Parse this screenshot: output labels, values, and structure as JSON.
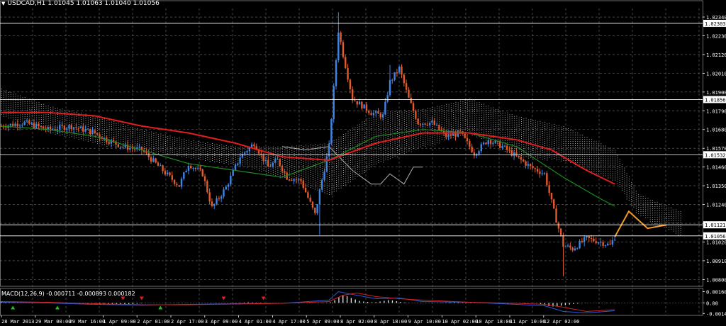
{
  "header": {
    "symbol": "USDCAD,H1",
    "quote": "1.01045 1.01063 1.01040 1.01056"
  },
  "macd_panel": {
    "label": "MACD(12,26,9) -0.000711 -0.000893 0.000182"
  },
  "colors": {
    "background": "#000000",
    "grid": "#6f6f6f",
    "bull_candle": "#3d85e6",
    "bear_candle": "#e05a2a",
    "ma_fast": "#1e8c1e",
    "ma_slow": "#e01e1e",
    "ichimoku_cloud": "#c9c9c9",
    "chikou": "#b0b0b0",
    "macd_hist": "#e8e8e8",
    "macd_main": "#2a5bd8",
    "macd_signal": "#d02020",
    "forecast": "#f59a23",
    "hline": "#ffffff"
  },
  "chart_data": [
    {
      "type": "candlestick",
      "title": "USDCAD,H1",
      "y_ticks": [
        "1.02340",
        "1.02230",
        "1.02120",
        "1.02010",
        "1.01900",
        "1.01790",
        "1.01680",
        "1.01570",
        "1.01460",
        "1.01350",
        "1.01240",
        "1.01130",
        "1.01020",
        "1.00910",
        "1.00800"
      ],
      "ylim": [
        1.0076,
        1.0239
      ],
      "horizontal_levels": [
        "1.02303",
        "1.01856",
        "1.01532",
        "1.01121",
        "1.01056"
      ],
      "x_ticks": [
        "28 Mar 2013",
        "29 Mar 00:00",
        "29 Mar 16:00",
        "1 Apr 09:00",
        "2 Apr 01:00",
        "2 Apr 17:00",
        "3 Apr 09:00",
        "4 Apr 01:00",
        "4 Apr 17:00",
        "5 Apr 09:00",
        "8 Apr 02:00",
        "8 Apr 18:00",
        "9 Apr 10:00",
        "10 Apr 02:00",
        "10 Apr 18:00",
        "11 Apr 10:00",
        "12 Apr 02:00"
      ],
      "close_path": [
        [
          0,
          1.017
        ],
        [
          10,
          1.0172
        ],
        [
          20,
          1.0168
        ],
        [
          30,
          1.017
        ],
        [
          40,
          1.0166
        ],
        [
          45,
          1.0162
        ],
        [
          52,
          1.0158
        ],
        [
          60,
          1.0156
        ],
        [
          66,
          1.0148
        ],
        [
          72,
          1.014
        ],
        [
          76,
          1.0135
        ],
        [
          80,
          1.0148
        ],
        [
          86,
          1.0142
        ],
        [
          90,
          1.0122
        ],
        [
          96,
          1.0134
        ],
        [
          102,
          1.0152
        ],
        [
          108,
          1.016
        ],
        [
          114,
          1.0146
        ],
        [
          118,
          1.015
        ],
        [
          122,
          1.014
        ],
        [
          128,
          1.0138
        ],
        [
          134,
          1.0118
        ],
        [
          136,
          1.0132
        ],
        [
          140,
          1.0158
        ],
        [
          144,
          1.0226
        ],
        [
          146,
          1.0212
        ],
        [
          150,
          1.0186
        ],
        [
          154,
          1.0182
        ],
        [
          158,
          1.0178
        ],
        [
          163,
          1.0176
        ],
        [
          166,
          1.0196
        ],
        [
          170,
          1.0204
        ],
        [
          174,
          1.0186
        ],
        [
          178,
          1.0172
        ],
        [
          184,
          1.0172
        ],
        [
          190,
          1.0164
        ],
        [
          196,
          1.0166
        ],
        [
          202,
          1.0154
        ],
        [
          208,
          1.0162
        ],
        [
          214,
          1.0158
        ],
        [
          220,
          1.0152
        ],
        [
          226,
          1.0146
        ],
        [
          232,
          1.0142
        ],
        [
          236,
          1.012
        ],
        [
          240,
          1.01
        ],
        [
          244,
          1.0098
        ],
        [
          250,
          1.0104
        ],
        [
          256,
          1.0102
        ],
        [
          260,
          1.01
        ],
        [
          262,
          1.0105
        ]
      ],
      "ma_fast": [
        [
          0,
          1.017
        ],
        [
          20,
          1.0168
        ],
        [
          40,
          1.0164
        ],
        [
          60,
          1.0156
        ],
        [
          80,
          1.0148
        ],
        [
          100,
          1.0144
        ],
        [
          120,
          1.014
        ],
        [
          140,
          1.015
        ],
        [
          160,
          1.0164
        ],
        [
          180,
          1.0168
        ],
        [
          200,
          1.0166
        ],
        [
          220,
          1.0158
        ],
        [
          240,
          1.014
        ],
        [
          255,
          1.0128
        ],
        [
          262,
          1.0123
        ]
      ],
      "ma_slow": [
        [
          0,
          1.0178
        ],
        [
          20,
          1.0178
        ],
        [
          40,
          1.0176
        ],
        [
          60,
          1.017
        ],
        [
          80,
          1.0166
        ],
        [
          100,
          1.016
        ],
        [
          120,
          1.0152
        ],
        [
          140,
          1.015
        ],
        [
          160,
          1.016
        ],
        [
          180,
          1.0166
        ],
        [
          200,
          1.0166
        ],
        [
          220,
          1.0162
        ],
        [
          235,
          1.0156
        ],
        [
          250,
          1.0144
        ],
        [
          262,
          1.0136
        ]
      ],
      "cloud_top": [
        [
          0,
          1.0192
        ],
        [
          20,
          1.0182
        ],
        [
          40,
          1.0176
        ],
        [
          60,
          1.0168
        ],
        [
          80,
          1.0162
        ],
        [
          100,
          1.0158
        ],
        [
          120,
          1.0158
        ],
        [
          140,
          1.016
        ],
        [
          160,
          1.0178
        ],
        [
          180,
          1.018
        ],
        [
          200,
          1.0186
        ],
        [
          220,
          1.0176
        ],
        [
          240,
          1.017
        ],
        [
          262,
          1.0156
        ],
        [
          272,
          1.013
        ],
        [
          290,
          1.012
        ]
      ],
      "cloud_bottom": [
        [
          0,
          1.0176
        ],
        [
          20,
          1.0166
        ],
        [
          40,
          1.016
        ],
        [
          60,
          1.0156
        ],
        [
          80,
          1.0152
        ],
        [
          100,
          1.0148
        ],
        [
          120,
          1.014
        ],
        [
          140,
          1.013
        ],
        [
          160,
          1.0148
        ],
        [
          180,
          1.0158
        ],
        [
          200,
          1.0166
        ],
        [
          220,
          1.0152
        ],
        [
          240,
          1.015
        ],
        [
          262,
          1.0138
        ],
        [
          272,
          1.0118
        ],
        [
          290,
          1.0106
        ]
      ],
      "chikou": [
        [
          120,
          1.0158
        ],
        [
          130,
          1.0156
        ],
        [
          140,
          1.0158
        ],
        [
          150,
          1.0144
        ],
        [
          158,
          1.0136
        ],
        [
          162,
          1.0136
        ],
        [
          166,
          1.0142
        ],
        [
          172,
          1.0136
        ],
        [
          176,
          1.0146
        ],
        [
          180,
          1.0146
        ]
      ],
      "forecast": [
        [
          262,
          1.0105
        ],
        [
          268,
          1.012
        ],
        [
          276,
          1.011
        ],
        [
          284,
          1.0112
        ]
      ]
    },
    {
      "type": "line",
      "title": "MACD(12,26,9) -0.000711 -0.000893 0.000182",
      "y_ticks": [
        "0.001605",
        "0.00",
        "-0.001475"
      ],
      "ylim": [
        -0.00175,
        0.00185
      ],
      "histogram": [
        0.0002,
        0.00018,
        0.00016,
        0.00015,
        0.00014,
        0.00012,
        0.0001,
        8e-05,
        6e-05,
        5e-05,
        4e-05,
        3e-05,
        2e-05,
        1e-05,
        0.0,
        -2e-05,
        -4e-05,
        -6e-05,
        -8e-05,
        -0.0001,
        -0.00012,
        -0.00015,
        -0.00018,
        -0.0002,
        -0.00022,
        -0.00024,
        -0.00025,
        -0.00026,
        -0.00026,
        -0.00025,
        -0.00022,
        -0.00018,
        -0.00014,
        -0.0001,
        -6e-05,
        -4e-05,
        -2e-05,
        -1e-05,
        0.0,
        1e-05,
        2e-05,
        3e-05,
        4e-05,
        4e-05,
        4e-05,
        3e-05,
        2e-05,
        1e-05,
        0.0,
        -1e-05,
        -2e-05,
        -3e-05,
        -3e-05,
        -2e-05,
        -1e-05,
        0.0,
        2e-05,
        4e-05,
        6e-05,
        8e-05,
        0.0001,
        8e-05,
        6e-05,
        4e-05,
        2e-05,
        1e-05,
        0.0,
        -1e-05,
        -2e-05,
        -3e-05,
        -4e-05,
        -3e-05,
        -2e-05,
        -1e-05,
        0.0,
        1e-05,
        2e-05,
        3e-05,
        4e-05,
        6e-05,
        0.0001,
        0.0004,
        0.0008,
        0.0011,
        0.00095,
        0.0007,
        0.0005,
        0.0003,
        0.0002,
        0.00015,
        0.0001,
        0.00012,
        0.0002,
        0.0003,
        0.0004,
        0.00035,
        0.00025,
        0.00015,
        8e-05,
        4e-05,
        2e-05,
        -2e-05,
        -4e-05,
        -3e-05,
        -2e-05,
        0.0,
        2e-05,
        4e-05,
        6e-05,
        8e-05,
        0.0001,
        0.00012,
        0.0001,
        8e-05,
        6e-05,
        4e-05,
        2e-05,
        0.0,
        -2e-05,
        -4e-05,
        -6e-05,
        -8e-05,
        -0.0001,
        -0.00012,
        -0.0001,
        -8e-05,
        -6e-05,
        -4e-05,
        -2e-05,
        0.0,
        -5e-05,
        -0.00015,
        -0.0003,
        -0.00045,
        -0.0005,
        -0.00045,
        -0.00038,
        -0.0003,
        -0.00022,
        -0.00015,
        -0.0001,
        -6e-05,
        -3e-05,
        -1e-05,
        1e-05,
        2e-05,
        3e-05,
        4e-05,
        5e-05,
        5e-05
      ],
      "macd_main": [
        [
          0,
          0.0001
        ],
        [
          20,
          0.0
        ],
        [
          40,
          -0.0002
        ],
        [
          60,
          -0.0003
        ],
        [
          80,
          -0.0002
        ],
        [
          100,
          -0.0001
        ],
        [
          120,
          -5e-05
        ],
        [
          140,
          0.0004
        ],
        [
          144,
          0.0016
        ],
        [
          150,
          0.0012
        ],
        [
          160,
          0.0006
        ],
        [
          170,
          0.0007
        ],
        [
          180,
          0.0002
        ],
        [
          200,
          0.0001
        ],
        [
          220,
          -0.0002
        ],
        [
          232,
          -0.0004
        ],
        [
          240,
          -0.0012
        ],
        [
          250,
          -0.0014
        ],
        [
          262,
          -0.0011
        ]
      ],
      "macd_signal": [
        [
          0,
          0.0002
        ],
        [
          20,
          0.0001
        ],
        [
          40,
          -0.0001
        ],
        [
          60,
          -0.00025
        ],
        [
          80,
          -0.00025
        ],
        [
          100,
          -0.00015
        ],
        [
          120,
          -5e-05
        ],
        [
          140,
          0.0002
        ],
        [
          146,
          0.0011
        ],
        [
          152,
          0.0014
        ],
        [
          160,
          0.0009
        ],
        [
          170,
          0.0006
        ],
        [
          180,
          0.0004
        ],
        [
          200,
          0.0001
        ],
        [
          220,
          -5e-05
        ],
        [
          232,
          -0.0002
        ],
        [
          240,
          -0.0006
        ],
        [
          250,
          -0.0012
        ],
        [
          262,
          -0.00095
        ]
      ],
      "arrows_up": [
        5,
        24,
        68
      ],
      "arrows_down": [
        52,
        60,
        95,
        112
      ]
    }
  ]
}
